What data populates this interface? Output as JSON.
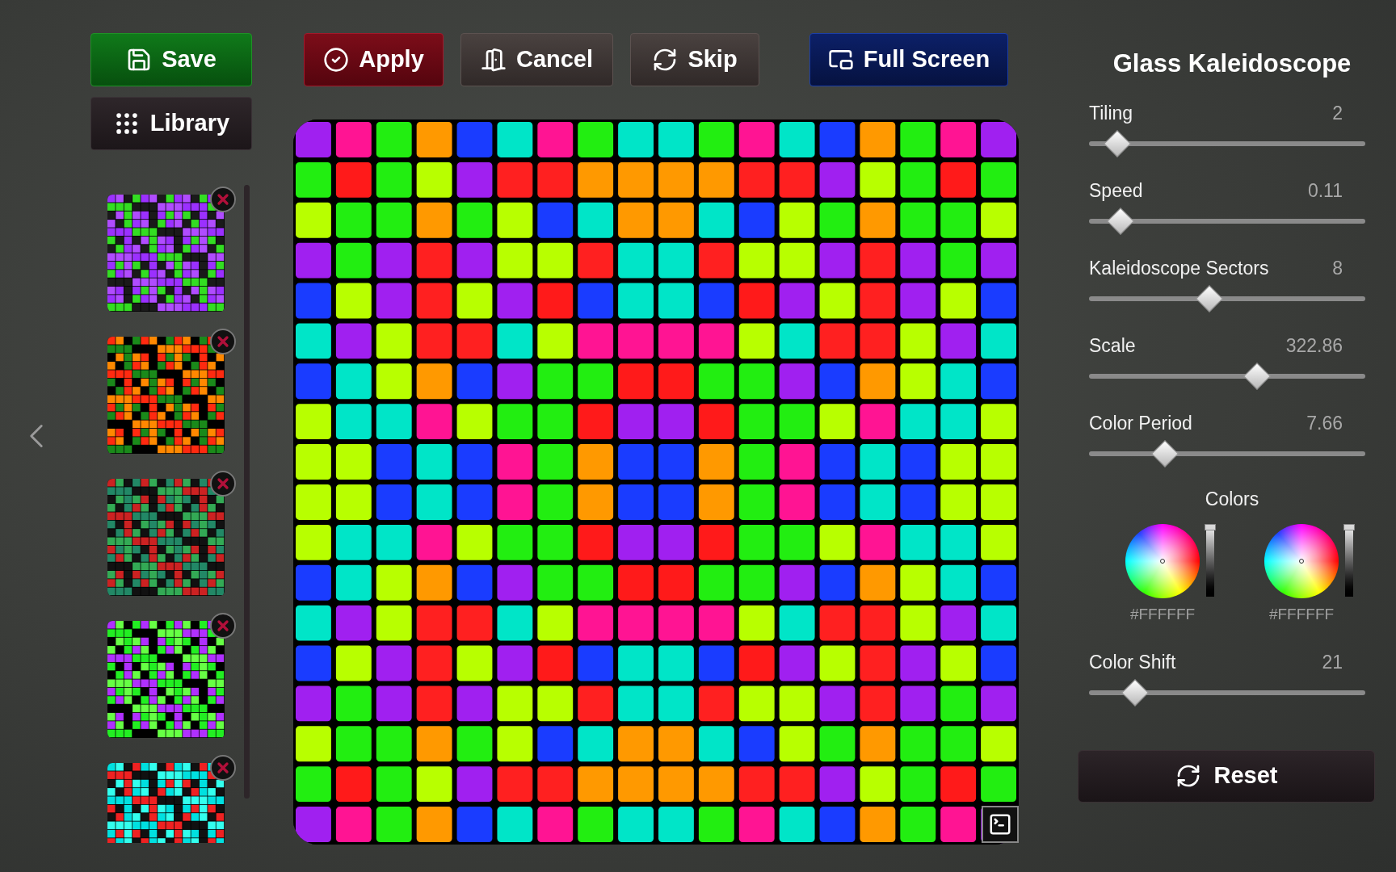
{
  "left_panel": {
    "save_button": {
      "label": "Save"
    },
    "library_button": {
      "label": "Library"
    },
    "presets": [
      {
        "kind": "purple-green"
      },
      {
        "kind": "red-green"
      },
      {
        "kind": "red-teal"
      },
      {
        "kind": "violet-lime"
      },
      {
        "kind": "cyan-red"
      }
    ]
  },
  "toolbar": {
    "buttons": [
      {
        "kind": "apply",
        "label": "Apply"
      },
      {
        "kind": "cancel",
        "label": "Cancel"
      },
      {
        "kind": "skip",
        "label": "Skip"
      },
      {
        "kind": "fullscreen",
        "label": "Full Screen"
      }
    ]
  },
  "settings": {
    "title": "Glass Kaleidoscope",
    "controls": [
      {
        "kind": "slider",
        "label": "Tiling",
        "value": "2",
        "level": 0.06
      },
      {
        "kind": "slider",
        "label": "Speed",
        "value": "0.11",
        "level": 0.07
      },
      {
        "kind": "slider",
        "label": "Kaleidoscope Sectors",
        "value": "8",
        "level": 0.43
      },
      {
        "kind": "slider",
        "label": "Scale",
        "value": "322.86",
        "level": 0.62
      },
      {
        "kind": "slider",
        "label": "Color Period",
        "value": "7.66",
        "level": 0.25
      },
      {
        "kind": "colors",
        "label": "Colors",
        "pickers": [
          {
            "hex": "#FFFFFF",
            "level": 1
          },
          {
            "hex": "#FFFFFF",
            "level": 1
          }
        ]
      },
      {
        "kind": "slider",
        "label": "Color Shift",
        "value": "21",
        "level": 0.13
      }
    ],
    "reset_button": {
      "label": "Reset"
    }
  }
}
